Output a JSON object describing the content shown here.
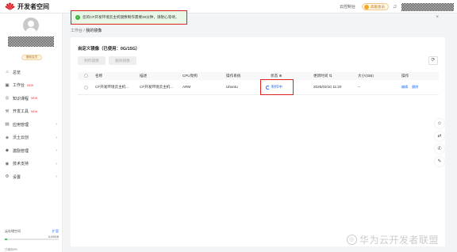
{
  "app": {
    "title": "开发者空间"
  },
  "topbar": {
    "link": "云控制台",
    "vip_label": "高级会员"
  },
  "alert": {
    "text": "您的CF开发环境云主机镜像制作需要30分钟，请耐心等待。",
    "close": "×"
  },
  "sidebar": {
    "member_badge": "基础会员",
    "items": [
      {
        "label": "总览",
        "icon": "⌂",
        "new": "",
        "arrow": ""
      },
      {
        "label": "工作台",
        "icon": "▣",
        "new": "NEW",
        "arrow": ""
      },
      {
        "label": "知识课程",
        "icon": "◎",
        "new": "NEW",
        "arrow": ""
      },
      {
        "label": "开发工具",
        "icon": "⚒",
        "new": "NEW",
        "arrow": ""
      },
      {
        "label": "应用管理",
        "icon": "▤",
        "new": "",
        "arrow": "›"
      },
      {
        "label": "沃土云创",
        "icon": "◈",
        "new": "",
        "arrow": "›"
      },
      {
        "label": "激励管理",
        "icon": "◆",
        "new": "",
        "arrow": "›"
      },
      {
        "label": "技术支持",
        "icon": "◉",
        "new": "",
        "arrow": "›"
      },
      {
        "label": "设置",
        "icon": "⚙",
        "new": "",
        "arrow": "›"
      }
    ],
    "storage": {
      "label": "云存储空间",
      "upgrade": "扩容",
      "limit": "0.0/5GB",
      "used": "已使用0%",
      "percent": 0.05
    }
  },
  "breadcrumb": {
    "root": "工作台",
    "sep": "/",
    "current": "我的镜像"
  },
  "main": {
    "title": "自定义镜像（已使用：0G/15G）",
    "make_button": "制作镜像",
    "delete_button": "删除镜像",
    "refresh_icon": "⟳",
    "table": {
      "headers": [
        "名称",
        "描述",
        "CPU架构",
        "操作系统",
        "状态 ⊕",
        "更新时间 ⇅",
        "大小(GiB)",
        "操作"
      ],
      "rows": [
        {
          "name": "CF开发环境云主机...",
          "desc": "CF开发环境云主机...",
          "cpu": "ARM",
          "os": "Ubuntu",
          "status": "制作中",
          "updated": "2025/03/10 11:20",
          "size": "--",
          "action1": "编辑",
          "action2": "删除"
        }
      ]
    }
  },
  "floating": [
    "☺",
    "⇄",
    "✆",
    "✎"
  ],
  "watermark": "华为云开发者联盟",
  "colors": {
    "primary": "#1a6dff",
    "success": "#3cb043",
    "highlight": "#dd2222"
  }
}
